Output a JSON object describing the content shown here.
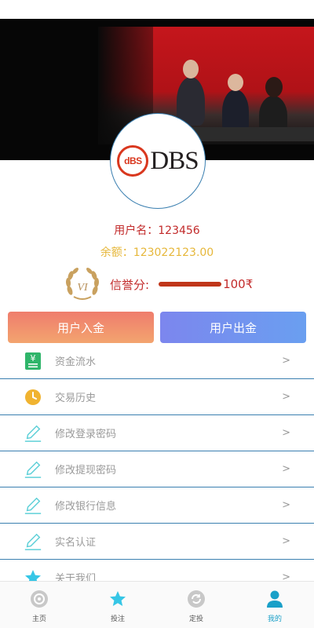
{
  "profile": {
    "username_text": "用户名：123456",
    "balance_text": "余额：123022123.00",
    "credit_label": "信誉分:",
    "credit_value": "100₹",
    "credit_fraction": 1.0,
    "vip_level": "VI",
    "logo": {
      "mark": "dBS",
      "word": "DBS"
    }
  },
  "actions": {
    "deposit_label": "用户入金",
    "withdraw_label": "用户出金"
  },
  "menu": [
    {
      "label": "资金流水",
      "icon": "yuan-receipt-icon",
      "chevron": ">"
    },
    {
      "label": "交易历史",
      "icon": "clock-icon",
      "chevron": ">"
    },
    {
      "label": "修改登录密码",
      "icon": "pencil-icon",
      "chevron": ">"
    },
    {
      "label": "修改提现密码",
      "icon": "pencil-icon",
      "chevron": ">"
    },
    {
      "label": "修改银行信息",
      "icon": "pencil-icon",
      "chevron": ">"
    },
    {
      "label": "实名认证",
      "icon": "pencil-icon",
      "chevron": ">"
    },
    {
      "label": "关于我们",
      "icon": "star-icon",
      "chevron": ">"
    }
  ],
  "tabs": [
    {
      "label": "主页",
      "icon": "home-icon",
      "active": false
    },
    {
      "label": "投注",
      "icon": "star-icon",
      "active": false
    },
    {
      "label": "定投",
      "icon": "refresh-icon",
      "active": false
    },
    {
      "label": "我的",
      "icon": "user-icon",
      "active": true
    }
  ],
  "colors": {
    "accent_red": "#c22a2a",
    "balance_gold": "#e6b73a",
    "divider_blue": "#3a7fb0",
    "active_tab": "#1aa0c8"
  }
}
